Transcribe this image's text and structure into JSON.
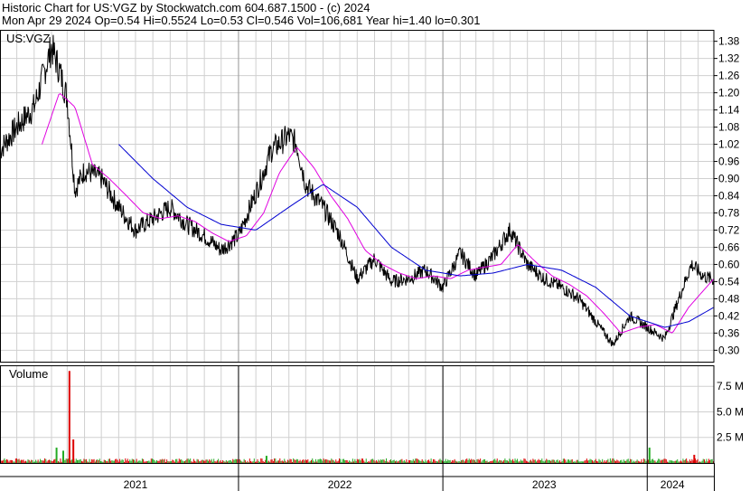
{
  "header": {
    "line1": "Historic Chart for US:VGZ by Stockwatch.com 604.687.1500 - (c) 2024",
    "line2": "Mon Apr 29 2024  Op=0.54  Hi=0.5524  Lo=0.53  Cl=0.546  Vol=106,681  Year hi=1.40  lo=0.301"
  },
  "colors": {
    "price": "#000000",
    "ma_short": "#e000e0",
    "ma_long": "#0000d0",
    "volume_up": "#22aa22",
    "volume_down": "#dd0000",
    "grid": "#d0d0d0",
    "border": "#000000"
  },
  "chart_data": [
    {
      "type": "line",
      "panel": "price",
      "label": "US:VGZ",
      "y_ticks": [
        "0.30",
        "0.36",
        "0.42",
        "0.48",
        "0.54",
        "0.60",
        "0.66",
        "0.72",
        "0.78",
        "0.84",
        "0.90",
        "0.96",
        "1.02",
        "1.08",
        "1.14",
        "1.20",
        "1.26",
        "1.32",
        "1.38"
      ],
      "ylim": [
        0.26,
        1.42
      ],
      "x_labels": [
        {
          "label": "2021",
          "date": "2021-07-01"
        },
        {
          "label": "2022",
          "date": "2022-07-01"
        },
        {
          "label": "2023",
          "date": "2023-07-01"
        },
        {
          "label": "2024",
          "date": "2024-02-15"
        }
      ],
      "year_boundaries": [
        "2022-01-01",
        "2023-01-01",
        "2024-01-01"
      ],
      "xlim": [
        "2020-11-01",
        "2024-04-29"
      ],
      "series": [
        {
          "role": "close",
          "points": [
            [
              "2020-11-01",
              1.0
            ],
            [
              "2020-12-01",
              1.08
            ],
            [
              "2021-01-01",
              1.15
            ],
            [
              "2021-02-01",
              1.36
            ],
            [
              "2021-02-15",
              1.28
            ],
            [
              "2021-03-01",
              1.18
            ],
            [
              "2021-03-15",
              0.86
            ],
            [
              "2021-04-01",
              0.93
            ],
            [
              "2021-05-01",
              0.9
            ],
            [
              "2021-06-01",
              0.8
            ],
            [
              "2021-07-01",
              0.72
            ],
            [
              "2021-08-01",
              0.76
            ],
            [
              "2021-09-01",
              0.8
            ],
            [
              "2021-10-01",
              0.74
            ],
            [
              "2021-11-01",
              0.7
            ],
            [
              "2021-12-01",
              0.65
            ],
            [
              "2022-01-01",
              0.7
            ],
            [
              "2022-02-01",
              0.85
            ],
            [
              "2022-03-01",
              1.0
            ],
            [
              "2022-04-01",
              1.05
            ],
            [
              "2022-04-15",
              1.02
            ],
            [
              "2022-05-01",
              0.88
            ],
            [
              "2022-06-01",
              0.8
            ],
            [
              "2022-07-01",
              0.7
            ],
            [
              "2022-08-01",
              0.55
            ],
            [
              "2022-09-01",
              0.62
            ],
            [
              "2022-10-01",
              0.54
            ],
            [
              "2022-11-01",
              0.55
            ],
            [
              "2022-12-01",
              0.58
            ],
            [
              "2023-01-01",
              0.52
            ],
            [
              "2023-02-01",
              0.64
            ],
            [
              "2023-03-01",
              0.56
            ],
            [
              "2023-04-01",
              0.63
            ],
            [
              "2023-05-01",
              0.72
            ],
            [
              "2023-06-01",
              0.6
            ],
            [
              "2023-07-01",
              0.55
            ],
            [
              "2023-08-01",
              0.52
            ],
            [
              "2023-09-01",
              0.48
            ],
            [
              "2023-10-01",
              0.4
            ],
            [
              "2023-11-01",
              0.32
            ],
            [
              "2023-12-01",
              0.42
            ],
            [
              "2024-01-01",
              0.38
            ],
            [
              "2024-02-01",
              0.34
            ],
            [
              "2024-03-01",
              0.5
            ],
            [
              "2024-03-20",
              0.6
            ],
            [
              "2024-04-10",
              0.56
            ],
            [
              "2024-04-29",
              0.546
            ]
          ]
        },
        {
          "role": "moving-average-short",
          "points": [
            [
              "2021-01-15",
              1.02
            ],
            [
              "2021-02-15",
              1.2
            ],
            [
              "2021-03-15",
              1.15
            ],
            [
              "2021-04-15",
              0.95
            ],
            [
              "2021-05-15",
              0.9
            ],
            [
              "2021-06-15",
              0.84
            ],
            [
              "2021-07-15",
              0.78
            ],
            [
              "2021-08-15",
              0.76
            ],
            [
              "2021-09-15",
              0.77
            ],
            [
              "2021-10-15",
              0.75
            ],
            [
              "2021-11-15",
              0.71
            ],
            [
              "2021-12-15",
              0.68
            ],
            [
              "2022-01-15",
              0.7
            ],
            [
              "2022-02-15",
              0.78
            ],
            [
              "2022-03-15",
              0.92
            ],
            [
              "2022-04-15",
              1.01
            ],
            [
              "2022-05-15",
              0.94
            ],
            [
              "2022-06-15",
              0.84
            ],
            [
              "2022-07-15",
              0.76
            ],
            [
              "2022-08-15",
              0.65
            ],
            [
              "2022-09-15",
              0.6
            ],
            [
              "2022-10-15",
              0.57
            ],
            [
              "2022-11-15",
              0.55
            ],
            [
              "2022-12-15",
              0.56
            ],
            [
              "2023-01-15",
              0.55
            ],
            [
              "2023-02-15",
              0.58
            ],
            [
              "2023-03-15",
              0.59
            ],
            [
              "2023-04-15",
              0.6
            ],
            [
              "2023-05-15",
              0.67
            ],
            [
              "2023-06-15",
              0.61
            ],
            [
              "2023-07-15",
              0.56
            ],
            [
              "2023-08-15",
              0.53
            ],
            [
              "2023-09-15",
              0.49
            ],
            [
              "2023-10-15",
              0.43
            ],
            [
              "2023-11-15",
              0.36
            ],
            [
              "2023-12-15",
              0.38
            ],
            [
              "2024-01-15",
              0.39
            ],
            [
              "2024-02-15",
              0.36
            ],
            [
              "2024-03-15",
              0.45
            ],
            [
              "2024-04-29",
              0.55
            ]
          ]
        },
        {
          "role": "moving-average-long",
          "points": [
            [
              "2021-06-01",
              1.02
            ],
            [
              "2021-08-01",
              0.9
            ],
            [
              "2021-10-01",
              0.8
            ],
            [
              "2021-12-01",
              0.74
            ],
            [
              "2022-02-01",
              0.72
            ],
            [
              "2022-04-01",
              0.8
            ],
            [
              "2022-06-01",
              0.88
            ],
            [
              "2022-08-01",
              0.8
            ],
            [
              "2022-10-01",
              0.66
            ],
            [
              "2022-12-01",
              0.58
            ],
            [
              "2023-02-01",
              0.56
            ],
            [
              "2023-04-01",
              0.57
            ],
            [
              "2023-06-01",
              0.6
            ],
            [
              "2023-08-01",
              0.58
            ],
            [
              "2023-10-01",
              0.52
            ],
            [
              "2023-12-01",
              0.42
            ],
            [
              "2024-02-01",
              0.38
            ],
            [
              "2024-03-15",
              0.4
            ],
            [
              "2024-04-29",
              0.45
            ]
          ]
        }
      ]
    },
    {
      "type": "bar",
      "panel": "volume",
      "label": "Volume",
      "y_ticks": [
        "2.5 M",
        "5.0 M",
        "7.5 M"
      ],
      "ylim": [
        0,
        9.2
      ],
      "unit": "M",
      "spikes": [
        {
          "date": "2021-03-05",
          "value": 9.0,
          "color": "down"
        },
        {
          "date": "2021-03-12",
          "value": 2.3,
          "color": "down"
        },
        {
          "date": "2021-02-10",
          "value": 1.5,
          "color": "up"
        },
        {
          "date": "2021-02-22",
          "value": 1.2,
          "color": "up"
        },
        {
          "date": "2022-02-20",
          "value": 0.7,
          "color": "up"
        },
        {
          "date": "2024-01-05",
          "value": 1.5,
          "color": "up"
        },
        {
          "date": "2024-03-25",
          "value": 0.8,
          "color": "down"
        }
      ],
      "baseline_volume": 0.3
    }
  ]
}
